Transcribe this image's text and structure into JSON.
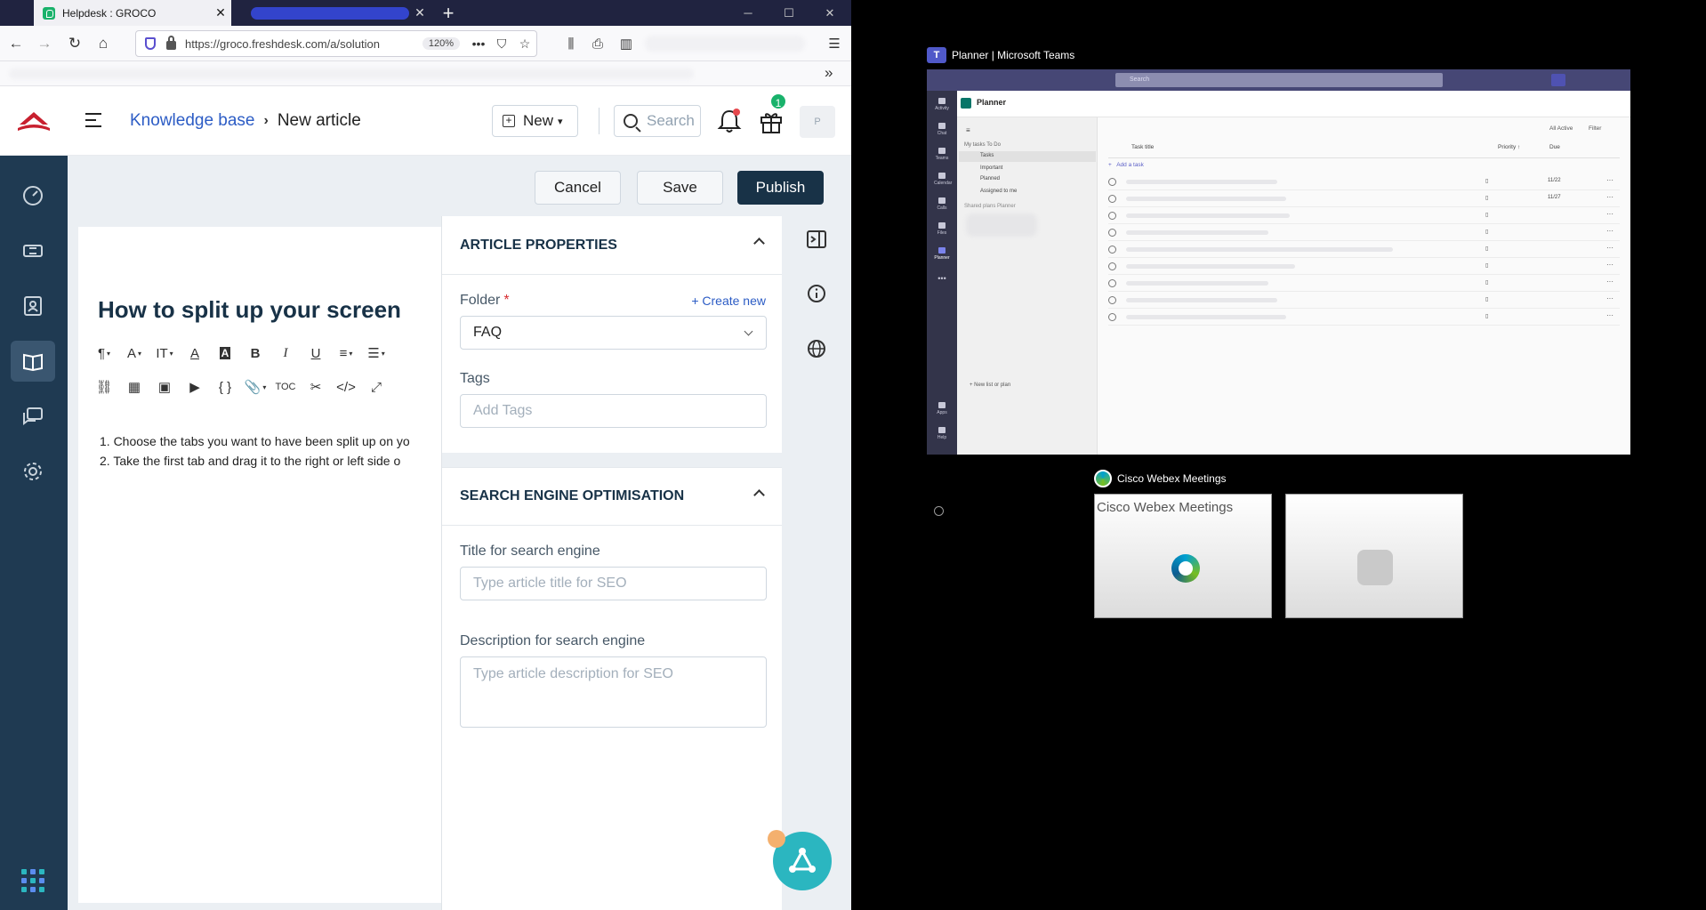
{
  "browser": {
    "active_tab_title": "Helpdesk : GROCO",
    "url": "https://groco.freshdesk.com/a/solution",
    "zoom": "120%"
  },
  "header": {
    "breadcrumb_link": "Knowledge base",
    "breadcrumb_current": "New article",
    "new_button": "New",
    "search_placeholder": "Search",
    "gift_badge": "1",
    "avatar_initial": "P"
  },
  "actions": {
    "cancel": "Cancel",
    "save": "Save",
    "publish": "Publish"
  },
  "article": {
    "title": "How to split up your screen",
    "list": [
      "1. Choose the tabs you want to have been split up on yo",
      "2. Take the first tab and drag it to the right or left side o"
    ],
    "toolbar_toc": "TOC"
  },
  "properties": {
    "section_title": "ARTICLE PROPERTIES",
    "folder_label": "Folder",
    "required_mark": "*",
    "create_new": "+ Create new",
    "folder_value": "FAQ",
    "tags_label": "Tags",
    "tags_placeholder": "Add Tags"
  },
  "seo": {
    "section_title": "SEARCH ENGINE OPTIMISATION",
    "title_label": "Title for search engine",
    "title_placeholder": "Type article title for SEO",
    "desc_label": "Description for search engine",
    "desc_placeholder": "Type article description for SEO"
  },
  "teams": {
    "window_title": "Planner | Microsoft Teams",
    "search": "Search",
    "app_title": "Planner",
    "filters": [
      "All Active",
      "Filter"
    ],
    "left_header": "My tasks  To Do",
    "left_items": [
      "Tasks",
      "Important",
      "Planned",
      "Assigned to me"
    ],
    "shared_plans": "Shared plans  Planner",
    "new_list": "New list or plan",
    "columns": [
      "Task title",
      "Priority ↑",
      "Due"
    ],
    "add_task": "Add a task",
    "due_dates": [
      "11/22",
      "11/27"
    ],
    "rail": [
      "Activity",
      "Chat",
      "Teams",
      "Calendar",
      "Calls",
      "Files",
      "Planner",
      "Apps",
      "Help"
    ]
  },
  "webex": {
    "window_title": "Cisco Webex Meetings",
    "card_label": "Cisco Webex Meetings"
  },
  "colors": {
    "sidebar": "#1f3a52",
    "publish": "#183247",
    "link": "#2c5cc5",
    "teams_rail": "#33344a"
  }
}
